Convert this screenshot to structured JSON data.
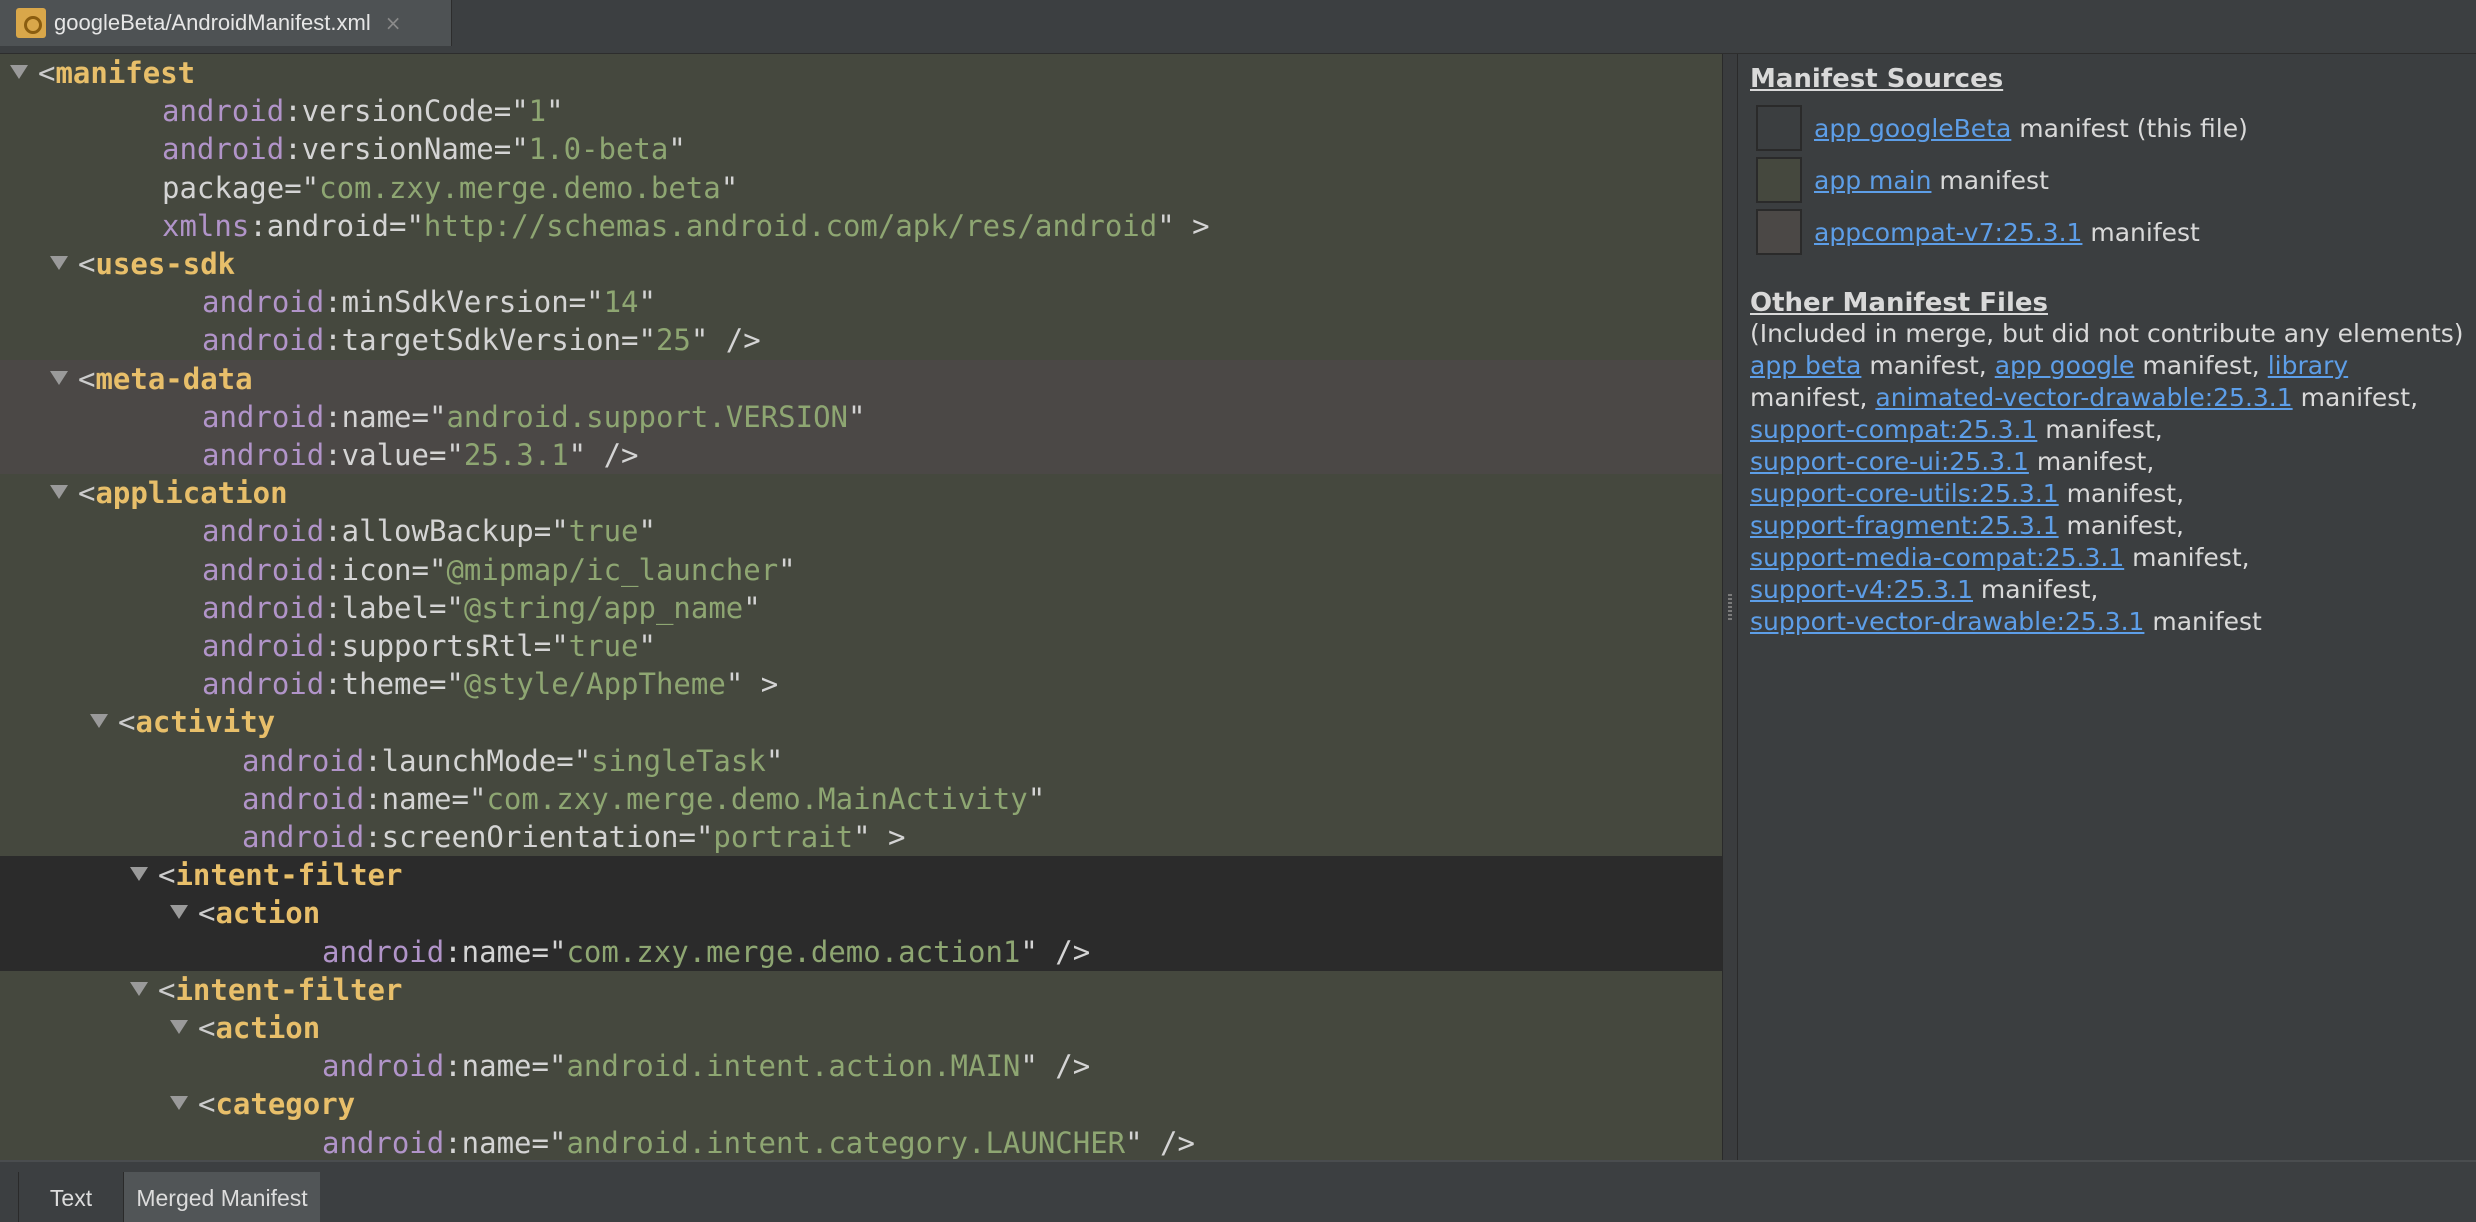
{
  "file_tab": {
    "label": "googleBeta/AndroidManifest.xml",
    "close": "×",
    "icon": "manifest-file-icon"
  },
  "editor": {
    "lines": [
      {
        "t": "tri",
        "indent": 0,
        "parts": [
          [
            "pn",
            "<"
          ],
          [
            "tg",
            "manifest"
          ]
        ]
      },
      {
        "indent": 2,
        "parts": [
          [
            "an",
            "android"
          ],
          [
            "at",
            ":versionCode=\""
          ],
          [
            "av",
            "1"
          ],
          [
            "at",
            "\""
          ]
        ]
      },
      {
        "indent": 2,
        "parts": [
          [
            "an",
            "android"
          ],
          [
            "at",
            ":versionName=\""
          ],
          [
            "av",
            "1.0-beta"
          ],
          [
            "at",
            "\""
          ]
        ]
      },
      {
        "indent": 2,
        "parts": [
          [
            "at",
            "package=\""
          ],
          [
            "av",
            "com.zxy.merge.demo.beta"
          ],
          [
            "at",
            "\""
          ]
        ]
      },
      {
        "indent": 2,
        "parts": [
          [
            "an",
            "xmlns"
          ],
          [
            "at",
            ":android=\""
          ],
          [
            "av",
            "http://schemas.android.com/apk/res/android"
          ],
          [
            "at",
            "\" >"
          ]
        ]
      },
      {
        "t": "tri",
        "indent": 1,
        "parts": [
          [
            "pn",
            "<"
          ],
          [
            "tg",
            "uses-sdk"
          ]
        ]
      },
      {
        "indent": 3,
        "parts": [
          [
            "an",
            "android"
          ],
          [
            "at",
            ":minSdkVersion=\""
          ],
          [
            "av",
            "14"
          ],
          [
            "at",
            "\""
          ]
        ]
      },
      {
        "indent": 3,
        "parts": [
          [
            "an",
            "android"
          ],
          [
            "at",
            ":targetSdkVersion=\""
          ],
          [
            "av",
            "25"
          ],
          [
            "at",
            "\" />"
          ]
        ]
      },
      {
        "t": "tri",
        "indent": 1,
        "hl": "meta",
        "parts": [
          [
            "pn",
            "<"
          ],
          [
            "tg",
            "meta-data"
          ]
        ]
      },
      {
        "indent": 3,
        "hl": "meta",
        "parts": [
          [
            "an",
            "android"
          ],
          [
            "at",
            ":name=\""
          ],
          [
            "av",
            "android.support.VERSION"
          ],
          [
            "at",
            "\""
          ]
        ]
      },
      {
        "indent": 3,
        "hl": "meta",
        "parts": [
          [
            "an",
            "android"
          ],
          [
            "at",
            ":value=\""
          ],
          [
            "av",
            "25.3.1"
          ],
          [
            "at",
            "\" />"
          ]
        ]
      },
      {
        "t": "tri",
        "indent": 1,
        "parts": [
          [
            "pn",
            "<"
          ],
          [
            "tg",
            "application"
          ]
        ]
      },
      {
        "indent": 3,
        "parts": [
          [
            "an",
            "android"
          ],
          [
            "at",
            ":allowBackup=\""
          ],
          [
            "av",
            "true"
          ],
          [
            "at",
            "\""
          ]
        ]
      },
      {
        "indent": 3,
        "parts": [
          [
            "an",
            "android"
          ],
          [
            "at",
            ":icon=\""
          ],
          [
            "av",
            "@mipmap/ic_launcher"
          ],
          [
            "at",
            "\""
          ]
        ]
      },
      {
        "indent": 3,
        "parts": [
          [
            "an",
            "android"
          ],
          [
            "at",
            ":label=\""
          ],
          [
            "av",
            "@string/app_name"
          ],
          [
            "at",
            "\""
          ]
        ]
      },
      {
        "indent": 3,
        "parts": [
          [
            "an",
            "android"
          ],
          [
            "at",
            ":supportsRtl=\""
          ],
          [
            "av",
            "true"
          ],
          [
            "at",
            "\""
          ]
        ]
      },
      {
        "indent": 3,
        "parts": [
          [
            "an",
            "android"
          ],
          [
            "at",
            ":theme=\""
          ],
          [
            "av",
            "@style/AppTheme"
          ],
          [
            "at",
            "\" >"
          ]
        ]
      },
      {
        "t": "tri",
        "indent": 2,
        "parts": [
          [
            "pn",
            "<"
          ],
          [
            "tg",
            "activity"
          ]
        ]
      },
      {
        "indent": 4,
        "parts": [
          [
            "an",
            "android"
          ],
          [
            "at",
            ":launchMode=\""
          ],
          [
            "av",
            "singleTask"
          ],
          [
            "at",
            "\""
          ]
        ]
      },
      {
        "indent": 4,
        "parts": [
          [
            "an",
            "android"
          ],
          [
            "at",
            ":name=\""
          ],
          [
            "av",
            "com.zxy.merge.demo.MainActivity"
          ],
          [
            "at",
            "\""
          ]
        ]
      },
      {
        "indent": 4,
        "parts": [
          [
            "an",
            "android"
          ],
          [
            "at",
            ":screenOrientation=\""
          ],
          [
            "av",
            "portrait"
          ],
          [
            "at",
            "\" >"
          ]
        ]
      },
      {
        "t": "tri",
        "indent": 3,
        "hl": "dark",
        "parts": [
          [
            "pn",
            "<"
          ],
          [
            "tg",
            "intent-filter"
          ]
        ]
      },
      {
        "t": "tri",
        "indent": 4,
        "hl": "dark",
        "parts": [
          [
            "pn",
            "<"
          ],
          [
            "tg",
            "action"
          ]
        ]
      },
      {
        "indent": 6,
        "hl": "dark",
        "parts": [
          [
            "an",
            "android"
          ],
          [
            "at",
            ":name=\""
          ],
          [
            "av",
            "com.zxy.merge.demo.action1"
          ],
          [
            "at",
            "\" />"
          ]
        ]
      },
      {
        "t": "tri",
        "indent": 3,
        "parts": [
          [
            "pn",
            "<"
          ],
          [
            "tg",
            "intent-filter"
          ]
        ]
      },
      {
        "t": "tri",
        "indent": 4,
        "parts": [
          [
            "pn",
            "<"
          ],
          [
            "tg",
            "action"
          ]
        ]
      },
      {
        "indent": 6,
        "parts": [
          [
            "an",
            "android"
          ],
          [
            "at",
            ":name=\""
          ],
          [
            "av",
            "android.intent.action.MAIN"
          ],
          [
            "at",
            "\" />"
          ]
        ]
      },
      {
        "t": "tri",
        "indent": 4,
        "parts": [
          [
            "pn",
            "<"
          ],
          [
            "tg",
            "category"
          ]
        ]
      },
      {
        "indent": 6,
        "parts": [
          [
            "an",
            "android"
          ],
          [
            "at",
            ":name=\""
          ],
          [
            "av",
            "android.intent.category.LAUNCHER"
          ],
          [
            "at",
            "\" />"
          ]
        ]
      }
    ]
  },
  "side": {
    "sources_title": "Manifest Sources",
    "sources": [
      {
        "link": "app googleBeta",
        "rest": " manifest (this file)",
        "color": "#3b3e40"
      },
      {
        "link": "app main",
        "rest": " manifest",
        "color": "#45483e"
      },
      {
        "link": "appcompat-v7:25.3.1",
        "rest": " manifest",
        "color": "#4b4846"
      }
    ],
    "other_title": "Other Manifest Files",
    "other_note": "(Included in merge, but did not contribute any elements)",
    "other_items": [
      {
        "link": "app beta",
        "rest": " manifest, "
      },
      {
        "link": "app google",
        "rest": " manifest, "
      },
      {
        "link": "library",
        "rest": " manifest, "
      },
      {
        "link": "animated-vector-drawable:25.3.1",
        "rest": " manifest,"
      },
      {
        "link": "support-compat:25.3.1",
        "rest": " manifest,"
      },
      {
        "link": "support-core-ui:25.3.1",
        "rest": " manifest,"
      },
      {
        "link": "support-core-utils:25.3.1",
        "rest": " manifest,"
      },
      {
        "link": "support-fragment:25.3.1",
        "rest": " manifest,"
      },
      {
        "link": "support-media-compat:25.3.1",
        "rest": " manifest,"
      },
      {
        "link": "support-v4:25.3.1",
        "rest": " manifest,"
      },
      {
        "link": "support-vector-drawable:25.3.1",
        "rest": " manifest"
      }
    ]
  },
  "bottom_tabs": {
    "text": "Text",
    "merged": "Merged Manifest"
  }
}
